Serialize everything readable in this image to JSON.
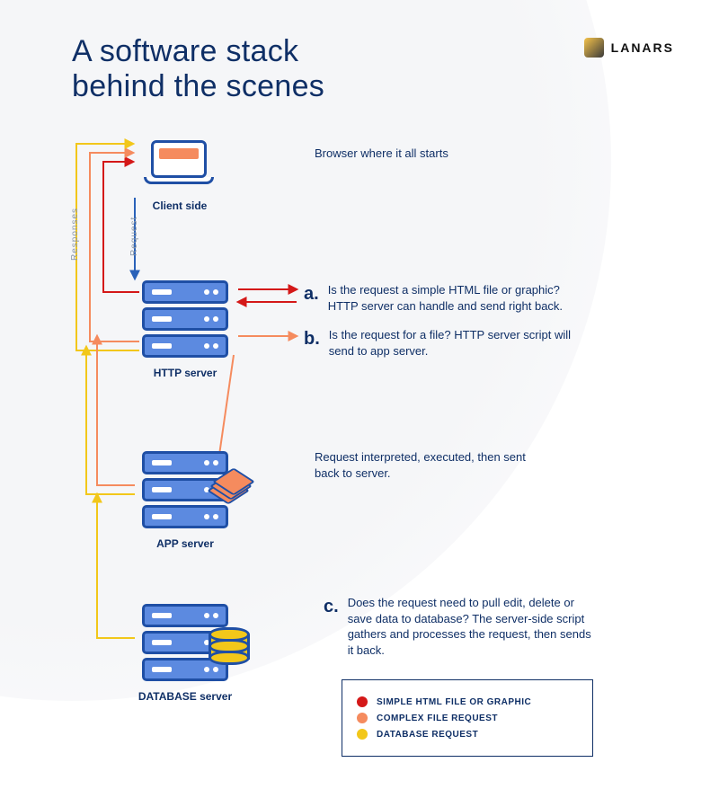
{
  "brand": {
    "name": "LANARS"
  },
  "title": "A software stack\nbehind the scenes",
  "sideLabels": {
    "responses": "Responses",
    "request": "Request"
  },
  "nodes": {
    "client": {
      "label": "Client side",
      "desc": "Browser where it all starts"
    },
    "http": {
      "label": "HTTP server",
      "a_lead": "a.",
      "a_text": "Is the request a simple HTML file or graphic? HTTP server can handle and send right back.",
      "b_lead": "b.",
      "b_text": "Is the request for a file? HTTP server script will send to app server."
    },
    "app": {
      "label": "APP server",
      "desc": "Request interpreted, executed, then sent back to server."
    },
    "db": {
      "label": "DATABASE server",
      "c_lead": "c.",
      "c_text": "Does the request need to pull edit, delete or save data to database? The server-side script gathers and processes the request, then sends it back."
    }
  },
  "legend": {
    "simple": "SIMPLE HTML FILE OR GRAPHIC",
    "complex": "COMPLEX FILE REQUEST",
    "database": "DATABASE REQUEST"
  },
  "colors": {
    "red": "#d41818",
    "orange": "#f58b5e",
    "yellow": "#f2c71a",
    "blue": "#1f4fa5",
    "darknavy": "#0f2f66"
  }
}
